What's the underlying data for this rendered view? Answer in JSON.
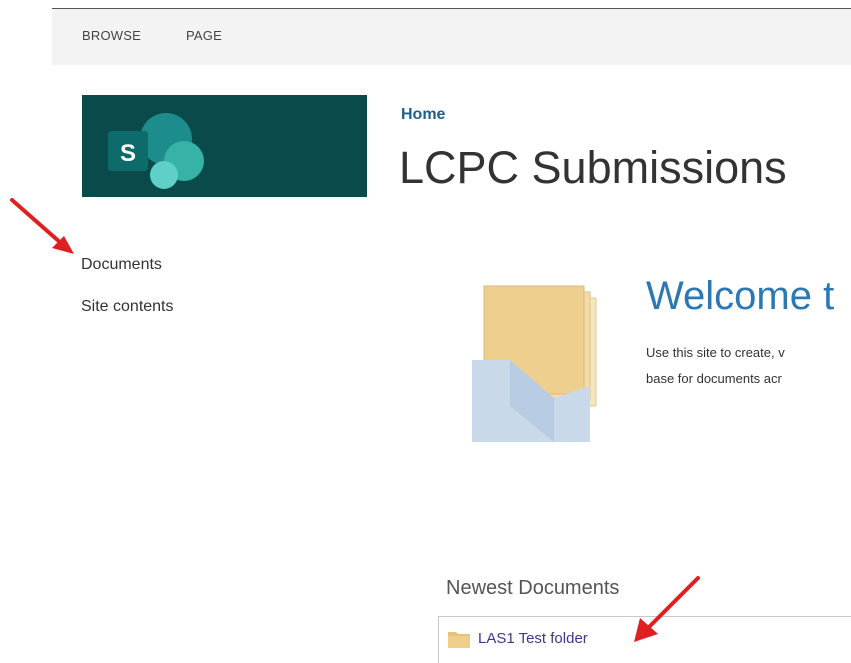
{
  "ribbon": {
    "tabs": [
      "BROWSE",
      "PAGE"
    ]
  },
  "site": {
    "breadcrumb": "Home",
    "title": "LCPC Submissions",
    "logo_letter": "S"
  },
  "nav": {
    "items": [
      "Documents",
      "Site contents"
    ]
  },
  "welcome": {
    "title": "Welcome t",
    "line1": "Use this site to create, v",
    "line2": "base for documents acr"
  },
  "newest": {
    "title": "Newest Documents",
    "items": [
      "LAS1 Test folder"
    ]
  },
  "colors": {
    "logo_bg": "#0b4a4a",
    "accent": "#2b78b5",
    "annotation_arrow": "#e02020",
    "folder": "#e8c27a"
  },
  "icons": [
    "sharepoint-logo-icon",
    "folder-icon",
    "documents-illustration-icon",
    "red-arrow-icon"
  ]
}
